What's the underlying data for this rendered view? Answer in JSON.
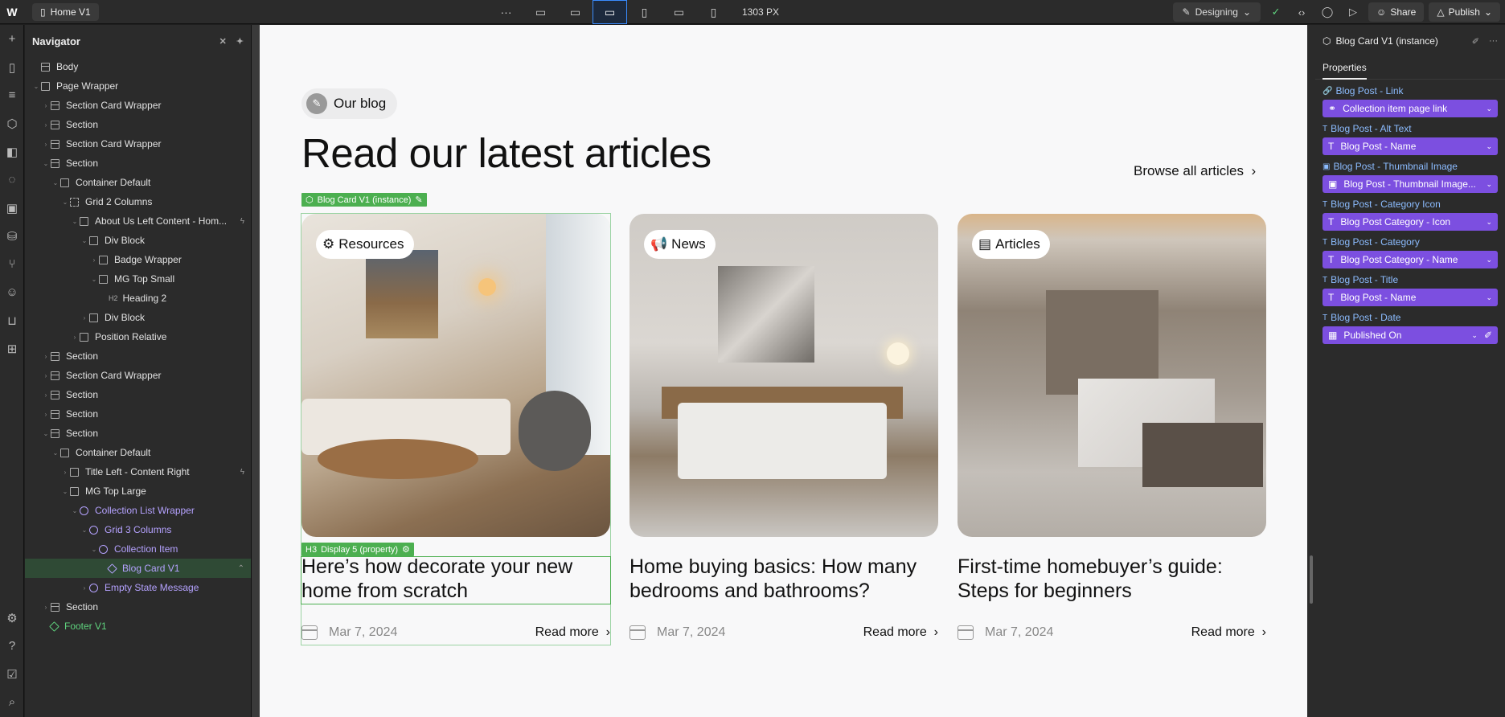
{
  "topbar": {
    "page_name": "Home V1",
    "more": "···",
    "breakpoint_px": "1303 PX",
    "mode": "Designing",
    "share": "Share",
    "publish": "Publish"
  },
  "navigator": {
    "title": "Navigator",
    "items": [
      {
        "label": "Body"
      },
      {
        "label": "Page Wrapper"
      },
      {
        "label": "Section Card Wrapper"
      },
      {
        "label": "Section"
      },
      {
        "label": "Section Card Wrapper"
      },
      {
        "label": "Section"
      },
      {
        "label": "Container Default"
      },
      {
        "label": "Grid 2 Columns"
      },
      {
        "label": "About Us Left Content - Hom..."
      },
      {
        "label": "Div Block"
      },
      {
        "label": "Badge Wrapper"
      },
      {
        "label": "MG Top Small"
      },
      {
        "label": "Heading 2",
        "tag": "H2"
      },
      {
        "label": "Div Block"
      },
      {
        "label": "Position Relative"
      },
      {
        "label": "Section"
      },
      {
        "label": "Section Card Wrapper"
      },
      {
        "label": "Section"
      },
      {
        "label": "Section"
      },
      {
        "label": "Section"
      },
      {
        "label": "Container Default"
      },
      {
        "label": "Title Left - Content Right"
      },
      {
        "label": "MG Top Large"
      },
      {
        "label": "Collection List Wrapper"
      },
      {
        "label": "Grid 3 Columns"
      },
      {
        "label": "Collection Item"
      },
      {
        "label": "Blog Card V1"
      },
      {
        "label": "Empty State Message"
      },
      {
        "label": "Section"
      },
      {
        "label": "Footer V1"
      }
    ]
  },
  "canvas": {
    "badge": "Our blog",
    "headline": "Read our latest articles",
    "browse": "Browse all articles",
    "instance_tag": "Blog Card V1 (instance)",
    "heading_tag": "Display 5 (property)",
    "heading_tag_prefix": "H3",
    "cards": [
      {
        "category": "Resources",
        "title": "Here’s how decorate your new home from scratch",
        "date": "Mar 7, 2024",
        "read": "Read more"
      },
      {
        "category": "News",
        "title": "Home buying basics: How many bedrooms and bathrooms?",
        "date": "Mar 7, 2024",
        "read": "Read more"
      },
      {
        "category": "Articles",
        "title": "First-time homebuyer’s guide: Steps for beginners",
        "date": "Mar 7, 2024",
        "read": "Read more"
      }
    ]
  },
  "properties": {
    "title": "Blog Card V1 (instance)",
    "tab": "Properties",
    "fields": [
      {
        "label": "Blog Post - Link",
        "value": "Collection item page link"
      },
      {
        "label": "Blog Post - Alt Text",
        "value": "Blog Post - Name"
      },
      {
        "label": "Blog Post - Thumbnail Image",
        "value": "Blog Post - Thumbnail Image..."
      },
      {
        "label": "Blog Post - Category Icon",
        "value": "Blog Post Category - Icon"
      },
      {
        "label": "Blog Post - Category",
        "value": "Blog Post Category - Name"
      },
      {
        "label": "Blog Post - Title",
        "value": "Blog Post - Name"
      },
      {
        "label": "Blog Post - Date",
        "value": "Published On"
      }
    ]
  }
}
